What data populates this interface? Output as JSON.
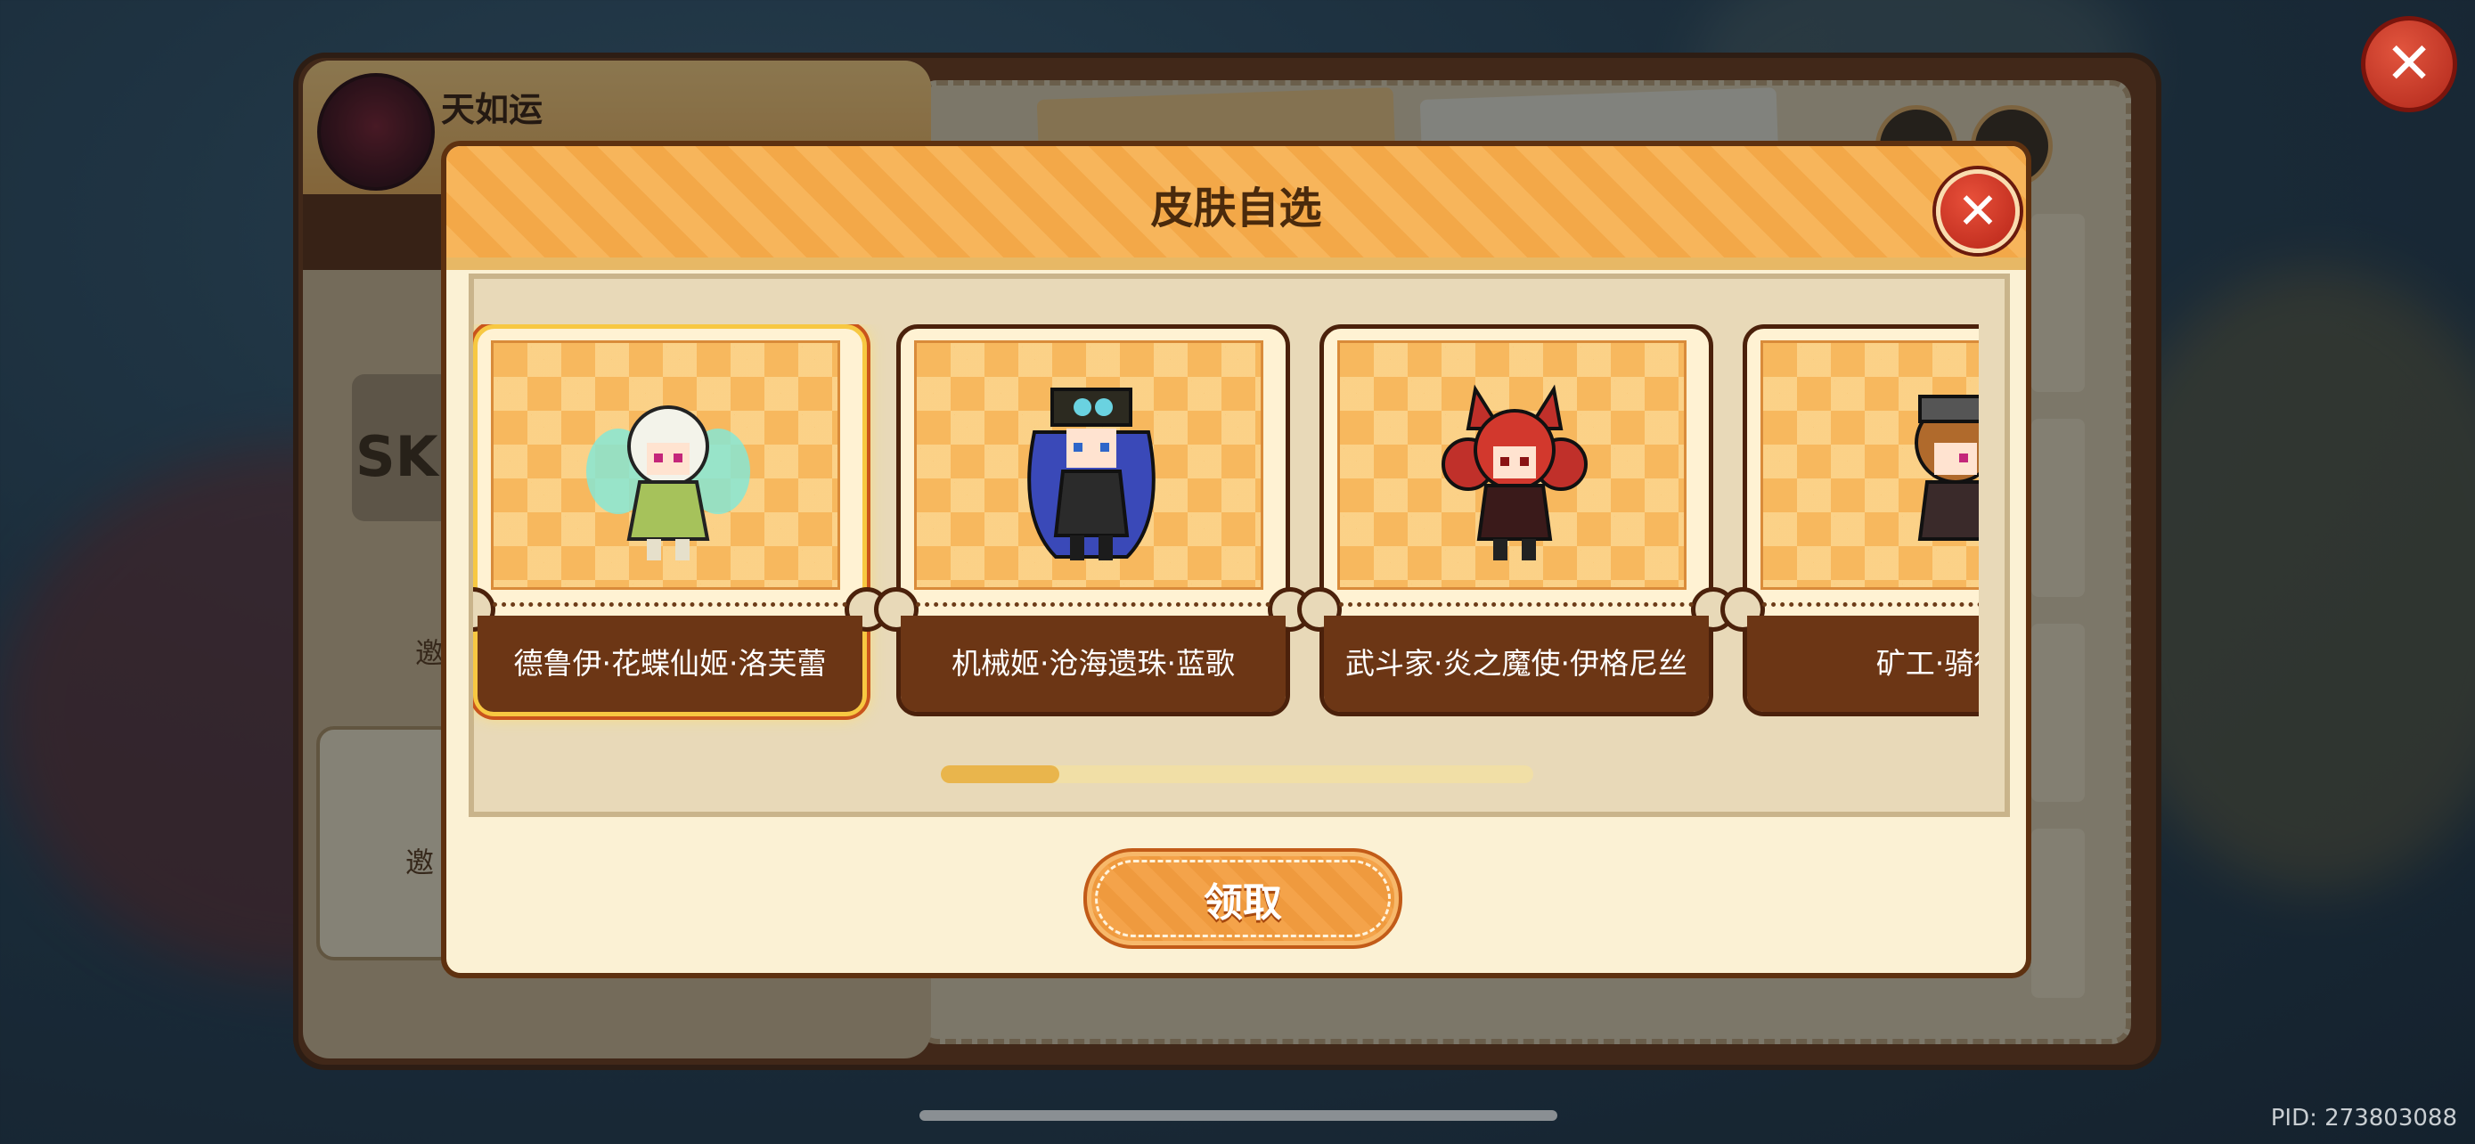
{
  "background": {
    "username": "天如运",
    "skin_tag": "SKI",
    "left_text_1": "邀",
    "left_text_2": "邀"
  },
  "modal": {
    "title": "皮肤自选",
    "close_icon": "close-icon",
    "claim_label": "领取",
    "carousel_progress": 0.2,
    "skins": [
      {
        "label": "德鲁伊·花蝶仙姬·洛芙蕾",
        "selected": true
      },
      {
        "label": "机械姬·沧海遗珠·蓝歌",
        "selected": false
      },
      {
        "label": "武斗家·炎之魔使·伊格尼丝",
        "selected": false
      },
      {
        "label": "矿工·骑行",
        "selected": false
      }
    ]
  },
  "top_close_icon": "close-icon",
  "pid": "PID: 273803088",
  "colors": {
    "accent": "#f3a848",
    "card_label_bg": "#6c3615",
    "selected_border": "#f7c842",
    "close_red": "#c4301f"
  }
}
